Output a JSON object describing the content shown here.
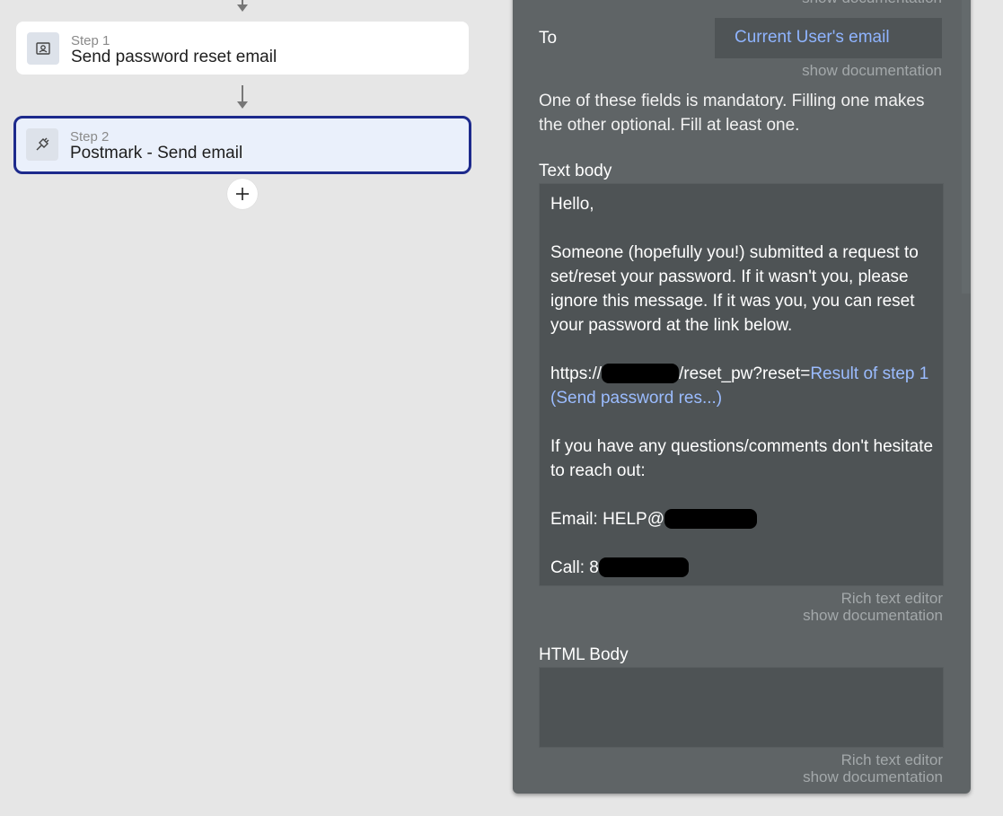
{
  "workflow": {
    "steps": [
      {
        "number_label": "Step 1",
        "title": "Send password reset email",
        "icon": "user-card-icon",
        "selected": false
      },
      {
        "number_label": "Step 2",
        "title": "Postmark - Send email",
        "icon": "plug-icon",
        "selected": true
      }
    ],
    "add_step_icon": "plus-icon"
  },
  "panel": {
    "top_doc_link": "show documentation",
    "to": {
      "label": "To",
      "value": "Current User's email",
      "doc_link": "show documentation"
    },
    "mandatory_note": "One of these fields is mandatory. Filling one makes the other optional. Fill at least one.",
    "text_body": {
      "label": "Text body",
      "greeting": "Hello,",
      "paragraph": "Someone (hopefully you!) submitted a request to set/reset your password. If it wasn't you, please ignore this message. If it was you, you can reset your password at the link below.",
      "url_prefix": "https://",
      "url_suffix": "/reset_pw?reset=",
      "dynamic_value": "Result of step 1 (Send password res...)",
      "questions": "If you have any questions/comments don't hesitate to reach out:",
      "email_prefix": "Email: HELP@",
      "call_prefix": "Call: 8",
      "rich_text_link": "Rich text editor",
      "doc_link": "show documentation"
    },
    "html_body": {
      "label": "HTML Body",
      "value": "",
      "rich_text_link": "Rich text editor",
      "doc_link": "show documentation"
    }
  },
  "colors": {
    "canvas_bg": "#e6e6e6",
    "panel_bg": "#5f6466",
    "input_bg": "#4e5355",
    "selected_border": "#1d2a8c",
    "selected_fill": "#eaf0fb",
    "dynamic_text": "#9bbcff"
  }
}
